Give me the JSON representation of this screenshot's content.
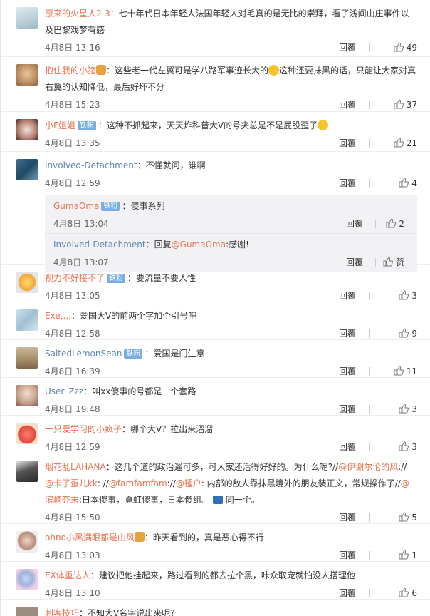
{
  "reply_label": "回覆",
  "comments": [
    {
      "user": "原来的火星人2-3",
      "text": "七十年代日本年轻人法国年轻人对毛真的是无比的崇拜，看了浅间山庄事件以及巴黎戏梦有感",
      "time": "4月8日 13:16",
      "likes": "49"
    },
    {
      "user": "抱住我的小猪",
      "text_pre": "这些老一代左翼可是学八路军事迹长大的",
      "text_post": "这种还要抹黑的话，只能让大家对真右翼的认知降低，最后好坏不分",
      "time": "4月8日 15:23",
      "likes": "37"
    },
    {
      "user": "小F姐姐",
      "badge": "铁粉",
      "text": "这种不抓起来，天天炸科普大V的号夹总是不是屁股歪了",
      "time": "4月8日 13:35",
      "likes": "21"
    },
    {
      "user": "Involved-Detachment",
      "text": "不懂就问，谁啊",
      "time": "4月8日 12:59",
      "likes": "4",
      "replies": [
        {
          "user": "GumaOma",
          "badge": "铁粉",
          "text": "傻事系列",
          "time": "4月8日 13:04",
          "likes": "2"
        },
        {
          "user": "Involved-Detachment",
          "text_pre": "回复",
          "mention": "@GumaOma",
          "text_post": ":感谢!",
          "time": "4月8日 13:07",
          "likes": "赞"
        }
      ]
    },
    {
      "user": "视力不好接不了",
      "badge": "铁粉",
      "text": "要流量不要人性",
      "time": "4月8日 13:05",
      "likes": "3"
    },
    {
      "user": "Exe,,,,",
      "text": "爱国大V的前两个字加个引号吧",
      "time": "4月8日 12:58",
      "likes": "9"
    },
    {
      "user": "SaltedLemonSean",
      "badge": "铁粉",
      "text": "爱国是门生意",
      "time": "4月8日 16:39",
      "likes": "11"
    },
    {
      "user": "User_Zzz",
      "text": "叫xx傻事的号都是一个套路",
      "time": "4月8日 19:48",
      "likes": "3"
    },
    {
      "user": "一只爱学习的小疯子",
      "text": "哪个大V？拉出来溜溜",
      "time": "4月8日 12:59",
      "likes": "3"
    },
    {
      "user": "烟花乱LAHANA",
      "text_a": "这几个道的政治遥可多，可人家还活得好好的。为什么呢?//",
      "m1": "@伊谢尔伦的风",
      "text_b": ":// ",
      "m2": "@卡了蛋儿kk",
      "text_c": ": //",
      "m3": "@famfamfam",
      "text_d": "://",
      "m4": "@锺户",
      "text_e": ": 内部的敌人靠抹黑境外的朋友装正义，常规操作了//",
      "m5": "@滨崎芥末",
      "text_f": ":日本傻事，覔虹傻事，日本傻组。",
      "text_g": "同一个。",
      "time": "4月8日 15:50",
      "likes": "5"
    },
    {
      "user": "ohno小黑满眼都是山风",
      "text": "昨天看到的，真是恶心得不行",
      "time": "4月8日 13:03",
      "likes": "1"
    },
    {
      "user": "EX体重达人",
      "text": "建议把他挂起来，路过看到的都去拉个黑，咔众取宠就怕没人搭理他",
      "time": "4月8日 13:10",
      "likes": "6"
    },
    {
      "user": "刺客技巧",
      "text": "不知大V名字说出来呢?",
      "time": "",
      "likes": ""
    }
  ]
}
